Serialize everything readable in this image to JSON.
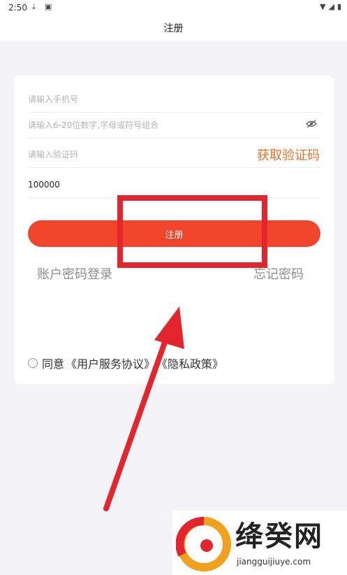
{
  "status_bar": {
    "time": "2:50",
    "left_icons": [
      "download-icon",
      "a-icon"
    ],
    "right_icons": [
      "wifi-icon",
      "signal-icon",
      "battery-icon"
    ]
  },
  "app_bar": {
    "title": "注册"
  },
  "form": {
    "phone": {
      "value": "",
      "placeholder": "请输入手机号"
    },
    "password": {
      "value": "",
      "placeholder": "请输入6-20位数字,字母或符号组合"
    },
    "code": {
      "value": "",
      "placeholder": "请输入验证码",
      "get_code_label": "获取验证码"
    },
    "invite": {
      "value": "100000",
      "placeholder": ""
    },
    "register_label": "注册"
  },
  "links": {
    "account_login": "账户密码登录",
    "forgot_password": "忘记密码"
  },
  "agreement": {
    "prefix": "同意",
    "terms": "《用户服务协议》",
    "privacy": "《隐私政策》"
  },
  "watermark": {
    "title": "绛癸网",
    "url": "jiangguijiuye.com"
  },
  "colors": {
    "accent": "#f0452a",
    "get_code": "#e8742a",
    "annotation": "#e3262d"
  }
}
